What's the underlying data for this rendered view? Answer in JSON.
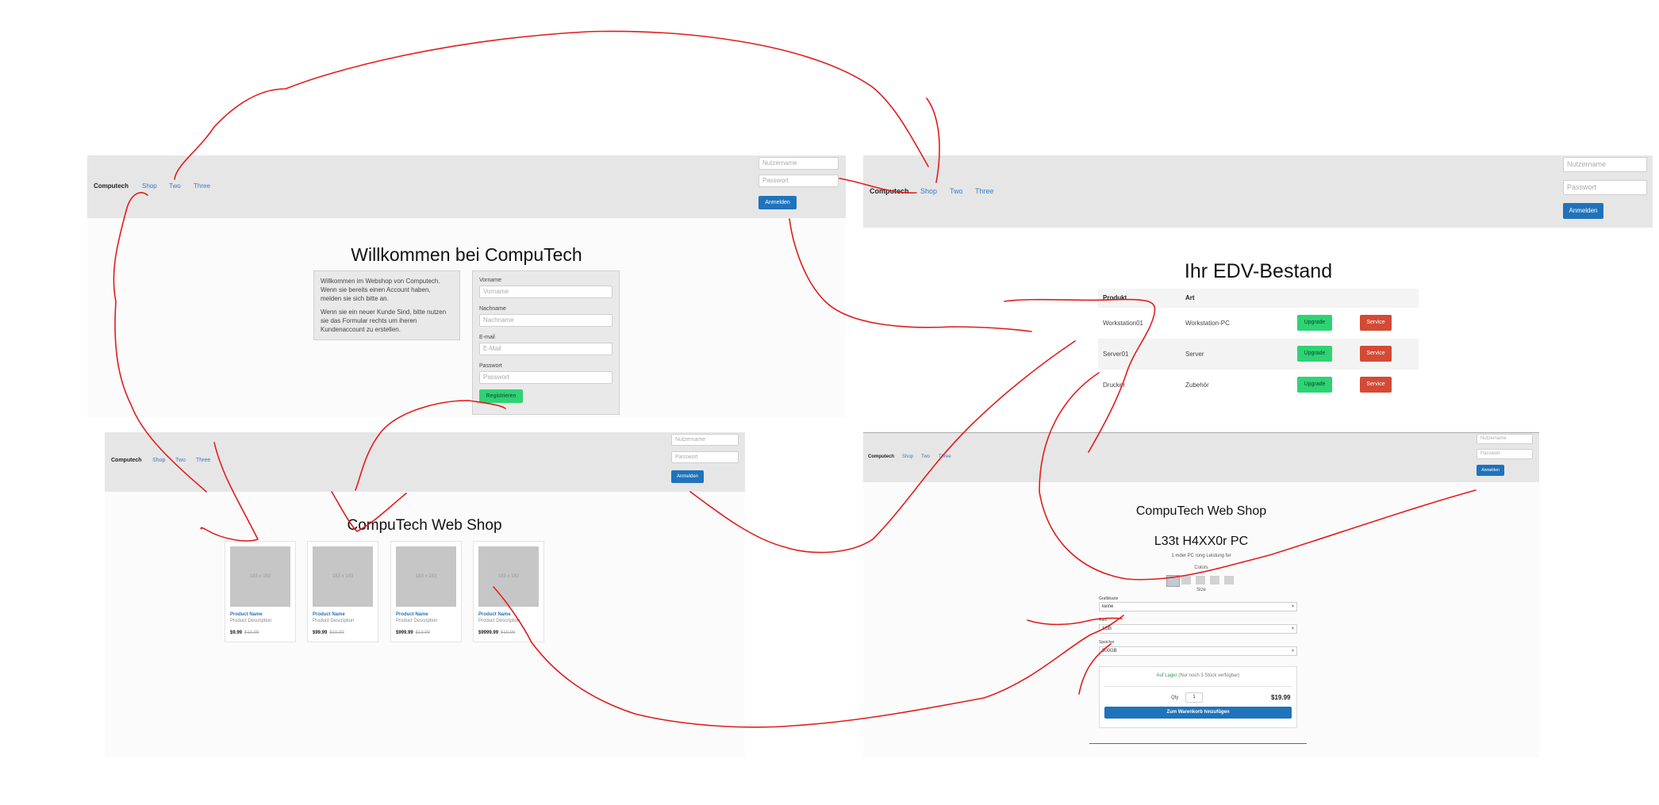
{
  "nav": {
    "brand": "Computech",
    "links": [
      "Shop",
      "Two",
      "Three"
    ],
    "username_placeholder": "Nutzername",
    "password_placeholder": "Passwort",
    "login_button": "Anmelden"
  },
  "welcome": {
    "title": "Willkommen bei CompuTech",
    "info_p1": "Willkommen im Webshop von Computech. Wenn sie bereits einen Account haben, melden sie sich bitte an.",
    "info_p2": "Wenn sie ein neuer Kunde Sind, bitte nutzen sie das Formular rechts um iheren Kundenaccount zu erstellen.",
    "form": {
      "firstname_label": "Vorname",
      "firstname_placeholder": "Vorname",
      "lastname_label": "Nachname",
      "lastname_placeholder": "Nachname",
      "email_label": "E-mail",
      "email_placeholder": "E-Mail",
      "password_label": "Passwort",
      "password_placeholder": "Passwort",
      "register_button": "Registrieren"
    }
  },
  "inventory": {
    "title": "Ihr EDV-Bestand",
    "columns": [
      "Produkt",
      "Art"
    ],
    "rows": [
      {
        "product": "Workstation01",
        "type": "Workstation-PC"
      },
      {
        "product": "Server01",
        "type": "Server"
      },
      {
        "product": "Drucker",
        "type": "Zubehör"
      }
    ],
    "upgrade_label": "Upgrade",
    "service_label": "Service"
  },
  "shop": {
    "title": "CompuTech Web Shop",
    "products": [
      {
        "image_text": "183 x 183",
        "name": "Product Name",
        "desc": "Product Description",
        "price": "$9.99",
        "old_price": "$19.99"
      },
      {
        "image_text": "183 x 183",
        "name": "Product Name",
        "desc": "Product Description",
        "price": "$99.99",
        "old_price": "$19.99"
      },
      {
        "image_text": "183 x 183",
        "name": "Product Name",
        "desc": "Product Description",
        "price": "$999.99",
        "old_price": "$19.99"
      },
      {
        "image_text": "183 x 183",
        "name": "Product Name",
        "desc": "Product Description",
        "price": "$9999.99",
        "old_price": "$19.99"
      }
    ]
  },
  "detail": {
    "title": "CompuTech Web Shop",
    "product_title": "L33t H4XX0r PC",
    "subtitle": "1 mder PC rong Leistung fer",
    "colors_label": "Colors",
    "size_label": "Size",
    "gpu_label": "Grafikkarte",
    "gpu_value": "keine",
    "ram_label": "Ram",
    "ram_value": "1GB",
    "storage_label": "Speicher",
    "storage_value": "500GB",
    "stock_status": "Auf Lager",
    "stock_note": "(Nur noch 3 Stück verfügbar)",
    "qty_label": "Qty",
    "qty_value": "1",
    "price": "$19.99",
    "add_to_cart": "Zum Warenkorb hinzufügen"
  },
  "colors": {
    "annotation": "#e31b1b",
    "nav_bg": "#e6e6e6",
    "primary": "#1f73bb",
    "success": "#2ed374",
    "danger": "#d44a35"
  }
}
